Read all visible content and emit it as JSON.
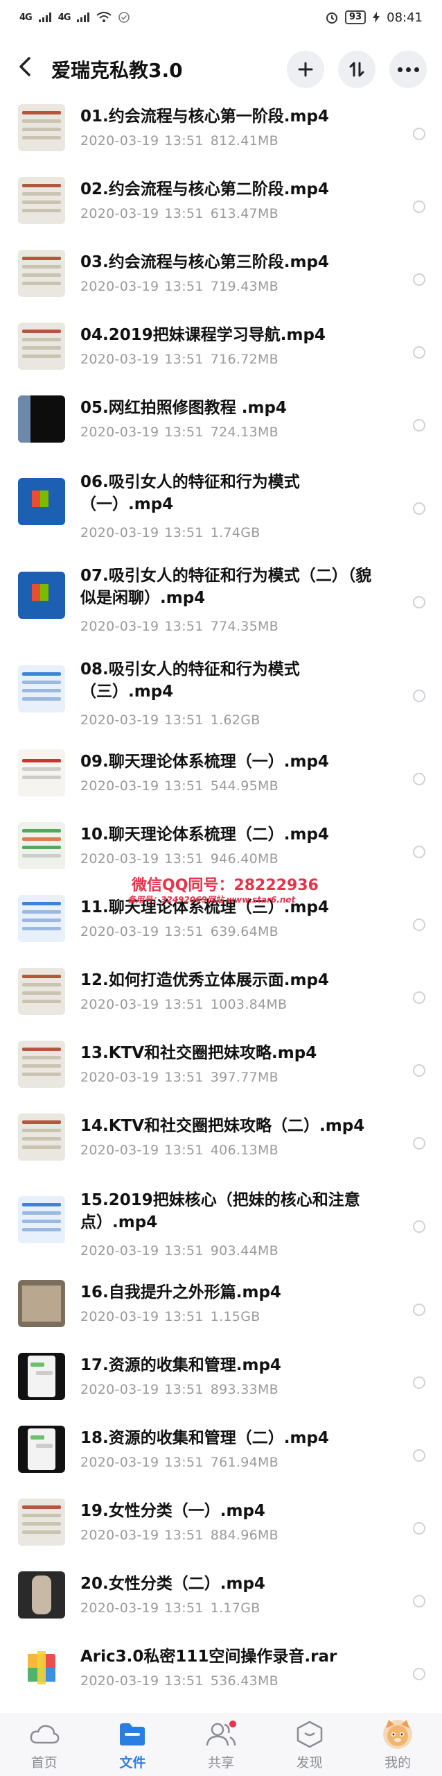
{
  "status_bar": {
    "signal1": "4G",
    "signal2": "4G",
    "battery": "93",
    "time": "08:41"
  },
  "header": {
    "title": "爱瑞克私教3.0",
    "add_icon": "plus-icon",
    "sort_icon": "sort-icon",
    "more_icon": "more-icon"
  },
  "files": [
    {
      "name": "01.约会流程与核心第一阶段.mp4",
      "date": "2020-03-19",
      "time": "13:51",
      "size": "812.41MB"
    },
    {
      "name": "02.约会流程与核心第二阶段.mp4",
      "date": "2020-03-19",
      "time": "13:51",
      "size": "613.47MB"
    },
    {
      "name": "03.约会流程与核心第三阶段.mp4",
      "date": "2020-03-19",
      "time": "13:51",
      "size": "719.43MB"
    },
    {
      "name": "04.2019把妹课程学习导航.mp4",
      "date": "2020-03-19",
      "time": "13:51",
      "size": "716.72MB"
    },
    {
      "name": "05.网红拍照修图教程 .mp4",
      "date": "2020-03-19",
      "time": "13:51",
      "size": "724.13MB"
    },
    {
      "name": "06.吸引女人的特征和行为模式（一）.mp4",
      "date": "2020-03-19",
      "time": "13:51",
      "size": "1.74GB"
    },
    {
      "name": "07.吸引女人的特征和行为模式（二）（貌似是闲聊）.mp4",
      "date": "2020-03-19",
      "time": "13:51",
      "size": "774.35MB"
    },
    {
      "name": "08.吸引女人的特征和行为模式（三）.mp4",
      "date": "2020-03-19",
      "time": "13:51",
      "size": "1.62GB"
    },
    {
      "name": "09.聊天理论体系梳理（一）.mp4",
      "date": "2020-03-19",
      "time": "13:51",
      "size": "544.95MB"
    },
    {
      "name": "10.聊天理论体系梳理（二）.mp4",
      "date": "2020-03-19",
      "time": "13:51",
      "size": "946.40MB"
    },
    {
      "name": "11.聊天理论体系梳理（三）.mp4",
      "date": "2020-03-19",
      "time": "13:51",
      "size": "639.64MB"
    },
    {
      "name": "12.如何打造优秀立体展示面.mp4",
      "date": "2020-03-19",
      "time": "13:51",
      "size": "1003.84MB"
    },
    {
      "name": "13.KTV和社交圈把妹攻略.mp4",
      "date": "2020-03-19",
      "time": "13:51",
      "size": "397.77MB"
    },
    {
      "name": "14.KTV和社交圈把妹攻略（二）.mp4",
      "date": "2020-03-19",
      "time": "13:51",
      "size": "406.13MB"
    },
    {
      "name": "15.2019把妹核心（把妹的核心和注意点）.mp4",
      "date": "2020-03-19",
      "time": "13:51",
      "size": "903.44MB"
    },
    {
      "name": "16.自我提升之外形篇.mp4",
      "date": "2020-03-19",
      "time": "13:51",
      "size": "1.15GB"
    },
    {
      "name": "17.资源的收集和管理.mp4",
      "date": "2020-03-19",
      "time": "13:51",
      "size": "893.33MB"
    },
    {
      "name": "18.资源的收集和管理（二）.mp4",
      "date": "2020-03-19",
      "time": "13:51",
      "size": "761.94MB"
    },
    {
      "name": "19.女性分类（一）.mp4",
      "date": "2020-03-19",
      "time": "13:51",
      "size": "884.96MB"
    },
    {
      "name": "20.女性分类（二）.mp4",
      "date": "2020-03-19",
      "time": "13:51",
      "size": "1.17GB"
    },
    {
      "name": "Aric3.0私密111空间操作录音.rar",
      "date": "2020-03-19",
      "time": "13:51",
      "size": "536.43MB"
    }
  ],
  "watermark": {
    "line1": "微信QQ同号：28222936",
    "line2": "备用号：32492069网站 www.star6.net"
  },
  "bottom_nav": [
    {
      "label": "首页",
      "icon": "cloud-icon",
      "active": false
    },
    {
      "label": "文件",
      "icon": "folder-icon",
      "active": true
    },
    {
      "label": "共享",
      "icon": "share-people-icon",
      "active": false
    },
    {
      "label": "发现",
      "icon": "discover-icon",
      "active": false
    },
    {
      "label": "我的",
      "icon": "avatar-icon",
      "active": false
    }
  ],
  "colors": {
    "accent": "#2a7de1",
    "meta": "#9a9a9a",
    "watermark": "#e8324a"
  }
}
